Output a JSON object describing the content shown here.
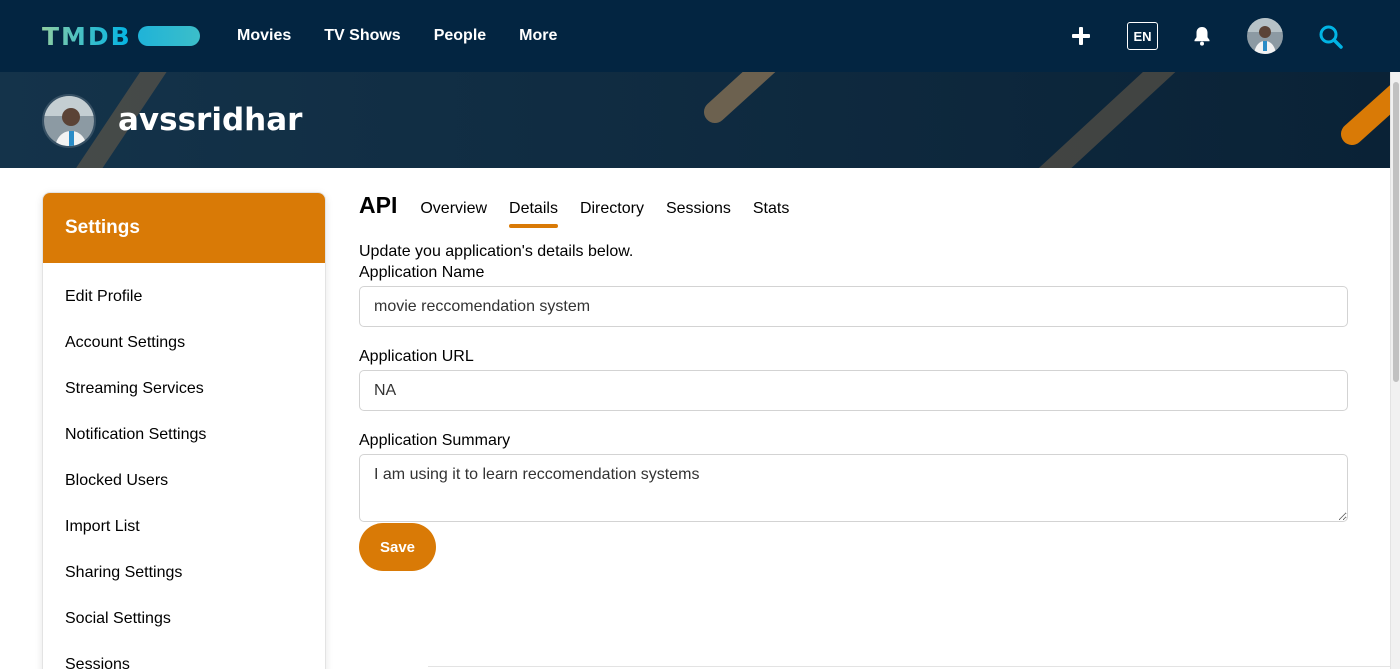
{
  "header": {
    "logo_text": "TMDB",
    "nav_links": [
      "Movies",
      "TV Shows",
      "People",
      "More"
    ],
    "language": "EN",
    "icons": [
      "plus-icon",
      "bell-icon",
      "avatar",
      "search-icon"
    ]
  },
  "profile": {
    "username": "avssridhar"
  },
  "sidebar": {
    "title": "Settings",
    "items": [
      {
        "label": "Edit Profile"
      },
      {
        "label": "Account Settings"
      },
      {
        "label": "Streaming Services"
      },
      {
        "label": "Notification Settings"
      },
      {
        "label": "Blocked Users"
      },
      {
        "label": "Import List"
      },
      {
        "label": "Sharing Settings"
      },
      {
        "label": "Social Settings"
      },
      {
        "label": "Sessions"
      }
    ]
  },
  "main": {
    "title": "API",
    "tabs": [
      {
        "label": "Overview",
        "active": false
      },
      {
        "label": "Details",
        "active": true
      },
      {
        "label": "Directory",
        "active": false
      },
      {
        "label": "Sessions",
        "active": false
      },
      {
        "label": "Stats",
        "active": false
      }
    ],
    "intro": "Update you application's details below.",
    "form": {
      "name_label": "Application Name",
      "name_value": "movie reccomendation system",
      "url_label": "Application URL",
      "url_value": "NA",
      "summary_label": "Application Summary",
      "summary_value": "I am using it to learn reccomendation systems",
      "save_label": "Save"
    }
  },
  "colors": {
    "nav_bg": "#032541",
    "accent": "#d97a06",
    "logo_gradient": [
      "#90cea1",
      "#01b4e4"
    ]
  }
}
